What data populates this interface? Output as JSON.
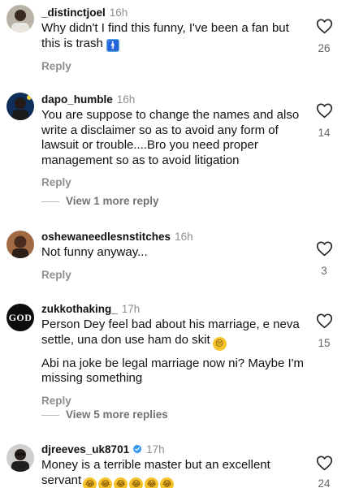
{
  "comments": [
    {
      "username": "_distinctjoel",
      "time": "16h",
      "text": "Why didn't I find this funny, I've been a fan but this is trash",
      "emoji": "🚹",
      "likes": "26",
      "reply_label": "Reply"
    },
    {
      "username": "dapo_humble",
      "time": "16h",
      "text": "You are suppose to change the names and also write a disclaimer so as to avoid any form of lawsuit or trouble....Bro you need proper management so as to avoid litigation",
      "likes": "14",
      "reply_label": "Reply",
      "more_replies": "View 1 more reply"
    },
    {
      "username": "oshewaneedlesnstitches",
      "time": "16h",
      "text": "Not funny anyway...",
      "likes": "3",
      "reply_label": "Reply"
    },
    {
      "username": "zukkothaking_",
      "time": "17h",
      "text": "Person Dey feel bad about his marriage, e neva settle, una don use ham do skit",
      "emoji": "😔",
      "text2": "Abi na joke be legal marriage now ni? Maybe I'm missing something",
      "avatar_text": "GOD",
      "likes": "15",
      "reply_label": "Reply",
      "more_replies": "View 5 more replies"
    },
    {
      "username": "djreeves_uk8701",
      "time": "17h",
      "text": "Money is a terrible master but an excellent servant",
      "emoji": "😂😂😂😂😂😂",
      "likes": "24"
    }
  ],
  "icons": {
    "like": "heart-outline-icon",
    "verified": "verified-badge-icon"
  },
  "colors": {
    "username": "#111111",
    "muted": "#8e8e8e",
    "verified": "#3897f0"
  }
}
